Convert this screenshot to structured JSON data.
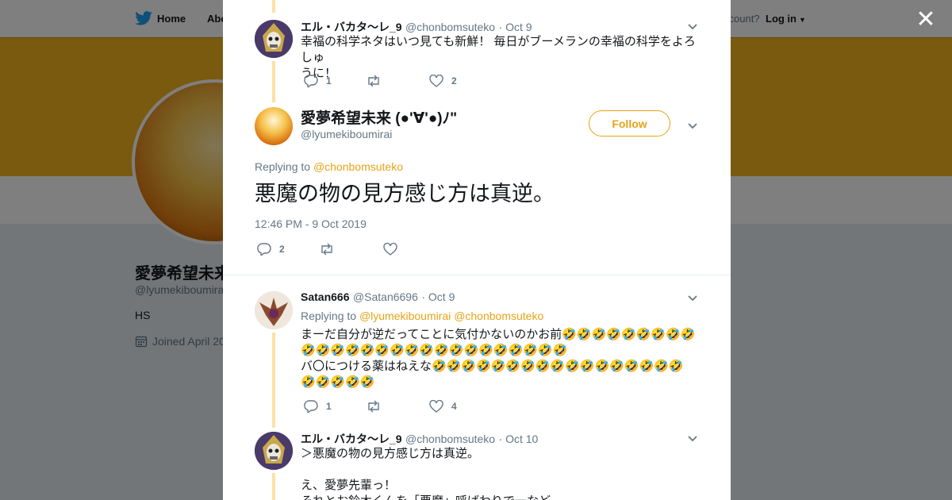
{
  "nav": {
    "home_label": "Home",
    "about_label": "Abo",
    "account_text": "ccount?",
    "login_label": "Log in"
  },
  "profile": {
    "name": "愛夢希望未来",
    "handle": "@lyumekiboumirai",
    "bio": "HS",
    "joined": "Joined April 20"
  },
  "colors": {
    "accent": "#E8A316",
    "banner": "#F5B51E"
  },
  "tweets": [
    {
      "name": "エル・バカタ～レ_9",
      "handle": "@chonbomsuteko",
      "date": "· Oct 9",
      "text1": "幸福の科学ネタはいつ見ても新鮮！ 毎日がブーメランの幸福の科学をよろしゅ",
      "text2": "うに！",
      "replies": "1",
      "likes": "2"
    },
    {
      "name": "Satan666",
      "handle": "@Satan6696",
      "date": "· Oct 9",
      "replying_prefix": "Replying to",
      "replying_to1": "@lyumekiboumirai",
      "replying_to2": "@chonbomsuteko",
      "line1": "まーだ自分が逆だってことに気付かないのかお前🤣🤣🤣🤣🤣🤣🤣🤣🤣",
      "line2": "🤣🤣🤣🤣🤣🤣🤣🤣🤣🤣🤣🤣🤣🤣🤣🤣🤣🤣",
      "line3": "バ〇につける薬はねえな🤣🤣🤣🤣🤣🤣🤣🤣🤣🤣🤣🤣🤣🤣🤣🤣🤣",
      "line4": "🤣🤣🤣🤣🤣",
      "replies": "1",
      "likes": "4"
    },
    {
      "name": "エル・バカタ～レ_9",
      "handle": "@chonbomsuteko",
      "date": "· Oct 10",
      "line1": "＞悪魔の物の見方感じ方は真逆。",
      "line2": "え、愛夢先輩っ！",
      "line3": "それとお鈴木くんを「悪魔」呼ばわりで一など"
    }
  ],
  "main_tweet": {
    "name": "愛夢希望未来 (●'∀'●)ﾉ\"",
    "handle": "@lyumekiboumirai",
    "follow_label": "Follow",
    "replying_prefix": "Replying to",
    "replying_to": "@chonbomsuteko",
    "text": "悪魔の物の見方感じ方は真逆。",
    "timestamp": "12:46 PM - 9 Oct 2019",
    "replies": "2"
  }
}
